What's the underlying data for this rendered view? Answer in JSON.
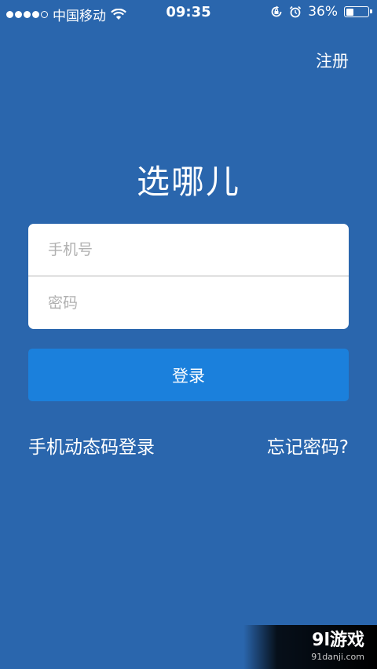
{
  "status_bar": {
    "carrier": "中国移动",
    "time": "09:35",
    "battery_percent": "36%",
    "battery_level": 0.36,
    "signal_bars_filled": 4,
    "signal_bars_total": 5,
    "icons": [
      "wifi-icon",
      "rotation-lock-icon",
      "alarm-icon",
      "battery-icon"
    ]
  },
  "header": {
    "register_label": "注册"
  },
  "app": {
    "title": "选哪儿"
  },
  "form": {
    "phone_placeholder": "手机号",
    "phone_value": "",
    "password_placeholder": "密码",
    "password_value": ""
  },
  "actions": {
    "login_label": "登录",
    "sms_login_label": "手机动态码登录",
    "forgot_password_label": "忘记密码?"
  },
  "watermark": {
    "logo": "9l游戏",
    "domain": "91danji.com"
  },
  "colors": {
    "background": "#2a66ad",
    "login_button": "#1b80dc",
    "input_bg": "#ffffff",
    "placeholder": "#b0b0b0"
  }
}
